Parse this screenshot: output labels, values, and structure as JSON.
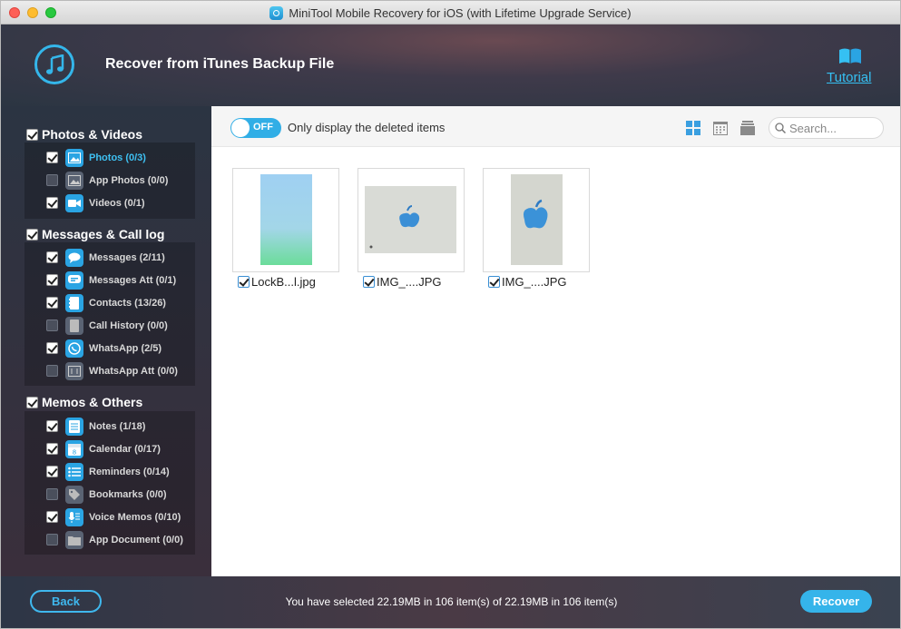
{
  "window": {
    "title": "MiniTool Mobile Recovery for iOS (with Lifetime Upgrade Service)"
  },
  "header": {
    "icon": "itunes-music-note-icon",
    "title": "Recover from iTunes Backup File",
    "tutorial_label": "Tutorial",
    "tutorial_icon": "book-icon",
    "accent_color": "#35c0f3"
  },
  "sidebar": {
    "groups": [
      {
        "label": "Photos & Videos",
        "checked": true,
        "items": [
          {
            "label": "Photos (0/3)",
            "checked": true,
            "active": true,
            "icon": "photo-icon"
          },
          {
            "label": "App Photos (0/0)",
            "checked": false,
            "active": false,
            "icon": "app-photo-icon"
          },
          {
            "label": "Videos (0/1)",
            "checked": true,
            "active": false,
            "icon": "video-icon"
          }
        ]
      },
      {
        "label": "Messages & Call log",
        "checked": true,
        "items": [
          {
            "label": "Messages (2/11)",
            "checked": true,
            "icon": "message-icon"
          },
          {
            "label": "Messages Att (0/1)",
            "checked": true,
            "icon": "message-attachment-icon"
          },
          {
            "label": "Contacts (13/26)",
            "checked": true,
            "icon": "contacts-icon"
          },
          {
            "label": "Call History (0/0)",
            "checked": false,
            "icon": "call-history-icon"
          },
          {
            "label": "WhatsApp (2/5)",
            "checked": true,
            "icon": "whatsapp-icon"
          },
          {
            "label": "WhatsApp Att (0/0)",
            "checked": false,
            "icon": "whatsapp-attachment-icon"
          }
        ]
      },
      {
        "label": "Memos & Others",
        "checked": true,
        "items": [
          {
            "label": "Notes (1/18)",
            "checked": true,
            "icon": "notes-icon"
          },
          {
            "label": "Calendar (0/17)",
            "checked": true,
            "icon": "calendar-icon"
          },
          {
            "label": "Reminders (0/14)",
            "checked": true,
            "icon": "reminders-icon"
          },
          {
            "label": "Bookmarks (0/0)",
            "checked": false,
            "icon": "bookmark-icon"
          },
          {
            "label": "Voice Memos (0/10)",
            "checked": true,
            "icon": "voice-memo-icon"
          },
          {
            "label": "App Document (0/0)",
            "checked": false,
            "icon": "app-document-icon"
          }
        ]
      }
    ]
  },
  "toolbar": {
    "toggle_label": "OFF",
    "toggle_on": false,
    "filter_label": "Only display the deleted items",
    "views": [
      "grid-view-icon",
      "calendar-view-icon",
      "list-view-icon"
    ],
    "search_placeholder": "Search..."
  },
  "files": [
    {
      "name": "LockB...l.jpg",
      "checked": true
    },
    {
      "name": "IMG_....JPG",
      "checked": true
    },
    {
      "name": "IMG_....JPG",
      "checked": true
    }
  ],
  "footer": {
    "back_label": "Back",
    "status": "You have selected 22.19MB in 106 item(s) of 22.19MB in 106 item(s)",
    "recover_label": "Recover"
  }
}
